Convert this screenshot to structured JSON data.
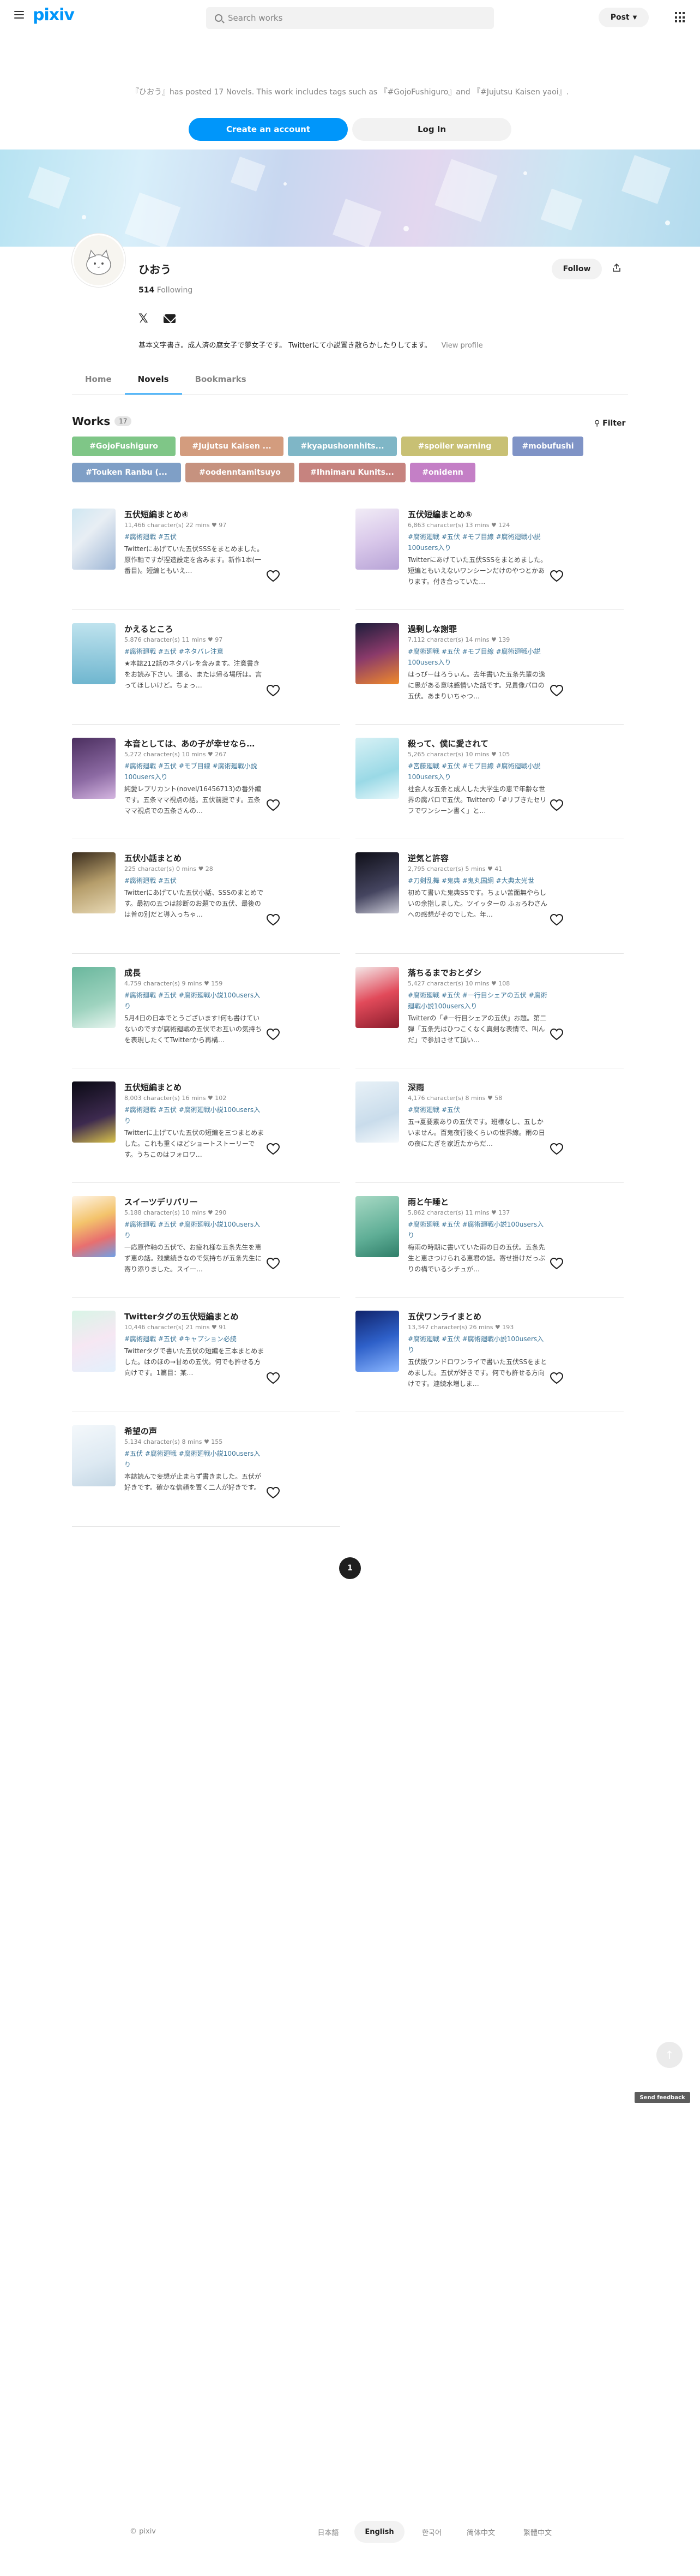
{
  "header": {
    "logo": "pixiv",
    "search_placeholder": "Search works",
    "post_label": "Post"
  },
  "intro": {
    "text": "『ひおう』has posted 17 Novels. This work includes tags such as 『#GojoFushiguro』and 『#Jujutsu Kaisen yaoi』.",
    "create_account": "Create an account",
    "login": "Log In"
  },
  "profile": {
    "name": "ひおう",
    "following_count": "514",
    "following_label": "Following",
    "follow_label": "Follow",
    "bio": "基本文字書き。成人済の腐女子で夢女子です。 Twitterにて小説置き散らかしたりしてます。",
    "view_profile": "View profile"
  },
  "tabs": [
    "Home",
    "Novels",
    "Bookmarks"
  ],
  "works": {
    "title": "Works",
    "count": "17",
    "filter_label": "Filter",
    "tags": [
      {
        "label": "#GojoFushiguro",
        "color": "#7fc687"
      },
      {
        "label": "#Jujutsu Kaisen ...",
        "color": "#d39c7e"
      },
      {
        "label": "#kyapushonnhits...",
        "color": "#7fb6c6"
      },
      {
        "label": "#spoiler warning",
        "color": "#c8c074"
      },
      {
        "label": "#mobufushi",
        "color": "#7f93c6"
      },
      {
        "label": "#Touken Ranbu (...",
        "color": "#7f9fc6"
      },
      {
        "label": "#oodenntamitsuyo",
        "color": "#c6927f"
      },
      {
        "label": "#Ihnimaru Kunits...",
        "color": "#c6837f"
      },
      {
        "label": "#onidenn",
        "color": "#c47fc6"
      }
    ],
    "cards": [
      {
        "title": "五伏短編まとめ④",
        "meta": "11,466 character(s)  22 mins  ♥ 97",
        "tags": "#腐術廻戦 #五伏",
        "desc": "Twitterにあげていた五伏SSSをまとめました。原作軸ですが捏造設定を含みます。新作1本(一番目)。短編ともいえ…"
      },
      {
        "title": "五伏短編まとめ⑤",
        "meta": "6,863 character(s)  13 mins  ♥ 124",
        "tags": "#腐術廻戦 #五伏 #モブ目線 #腐術廻戦小説100users入り",
        "desc": "Twitterにあげていた五伏SSSをまとめました。短編ともいえないワンシーンだけのやつとかあります。付き合っていた…"
      },
      {
        "title": "かえるところ",
        "meta": "5,876 character(s)  11 mins  ♥ 97",
        "tags": "#腐術廻戦 #五伏 #ネタバレ注意",
        "desc": "★本誌212話のネタバレを含みます。注意書きをお読み下さい。還る、または帰る場所は。言ってほしいけど。ちょっ…"
      },
      {
        "title": "過剰しな謝罪",
        "meta": "7,112 character(s)  14 mins  ♥ 139",
        "tags": "#腐術廻戦 #五伏 #モブ目線 #腐術廻戦小説100users入り",
        "desc": "はっぴーはろうぃん。去年書いた五条先輩の逸に愚がある意味感情いた話です。兄貴像パロの五伏。あまりいちゃつ…"
      },
      {
        "title": "本音としては、あの子が幸せなら…",
        "meta": "5,272 character(s)  10 mins  ♥ 267",
        "tags": "#腐術廻戦 #五伏 #モブ目線 #腐術廻戦小説100users入り",
        "desc": "純愛レプリカント(novel/16456713)の番外編です。五条ママ視点の話。五伏前提です。五条ママ視点での五条さんの…"
      },
      {
        "title": "殺って、僕に愛されて",
        "meta": "5,265 character(s)  10 mins  ♥ 105",
        "tags": "#宮藤廻戦 #五伏 #モブ目線 #腐術廻戦小説100users入り",
        "desc": "社会人な五条と成人した大学生の恵で年齢な世界の腐パロで五伏。Twitterの「#リプきたセリフでワンシーン書く」と…"
      },
      {
        "title": "五伏小話まとめ",
        "meta": "225 character(s)  0 mins  ♥ 28",
        "tags": "#腐術廻戦 #五伏",
        "desc": "Twitterにあげていた五伏小話、SSSのまとめです。最初の五つは診断のお題での五伏、最後のは普の別だと導入っちゃ…"
      },
      {
        "title": "逆気と許容",
        "meta": "2,795 character(s)  5 mins  ♥ 41",
        "tags": "#刀剣乱舞 #鬼典 #鬼丸国綱 #大典太光世",
        "desc": "初めて書いた鬼典SSです。ちょい苦面無やらしいの余指しました。ツイッターの ふぉろわさんへの感想がそのでした。年…"
      },
      {
        "title": "成長",
        "meta": "4,759 character(s)  9 mins  ♥ 159",
        "tags": "#腐術廻戦 #五伏 #腐術廻戦小説100users入り",
        "desc": "5月4日の日本でとうございます!何も書けていないのですが腐術廻戦の五伏でお互いの気持ちを表現したくてTwitterから再構…"
      },
      {
        "title": "落ちるまでおとダシ",
        "meta": "5,427 character(s)  10 mins  ♥ 108",
        "tags": "#腐術廻戦 #五伏 #一行目シェアの五伏 #腐術廻戦小説100users入り",
        "desc": "Twitterの「#一行目シェアの五伏」お題。第二弾「五条先はひつこくなく真剣な表情で、叫んだ」で参加させて頂い…"
      },
      {
        "title": "五伏短編まとめ",
        "meta": "8,003 character(s)  16 mins  ♥ 102",
        "tags": "#腐術廻戦 #五伏 #腐術廻戦小説100users入り",
        "desc": "Twitterに上げていた五伏の短編を三つまとめました。これも重くほどショートストーリーです。うちこのはフォロワ…"
      },
      {
        "title": "深雨",
        "meta": "4,176 character(s)  8 mins  ♥ 58",
        "tags": "#腐術廻戦 #五伏",
        "desc": "五→夏要素ありの五伏です。班様なし、五しかいません。百鬼夜行後くらいの世界線。雨の日の夜にたぎを家近たからだ…"
      },
      {
        "title": "スイーツデリバリー",
        "meta": "5,188 character(s)  10 mins  ♥ 290",
        "tags": "#腐術廻戦 #五伏 #腐術廻戦小説100users入り",
        "desc": "一応原作軸の五伏で、お疲れ様な五条先生を恵ず恵の話。残業続きなので気持ちが五条先生に寄り添りました。スイー…"
      },
      {
        "title": "雨と午睡と",
        "meta": "5,862 character(s)  11 mins  ♥ 137",
        "tags": "#腐術廻戦 #五伏 #腐術廻戦小説100users入り",
        "desc": "梅雨の時期に書いていた雨の日の五伏。五条先生と恵さつけられる恵君の話。寄せ掛けだっぷりの構でいるシチュが…"
      },
      {
        "title": "Twitterタグの五伏短編まとめ",
        "meta": "10,446 character(s)  21 mins  ♥ 91",
        "tags": "#腐術廻戦 #五伏 #キャプション必読",
        "desc": "Twitterタグで書いた五伏の短編を三本まとめました。はのほの→甘めの五伏。何でも許せる方向けです。1篇目：某…"
      },
      {
        "title": "五伏ワンライまとめ",
        "meta": "13,347 character(s)  26 mins  ♥ 193",
        "tags": "#腐術廻戦 #五伏 #腐術廻戦小説100users入り",
        "desc": "五伏版ワンドロワンライで書いた五伏SSをまとめました。五伏が好きです。何でも許せる方向けです。連続水増しま…"
      },
      {
        "title": "希望の声",
        "meta": "5,134 character(s)  8 mins  ♥ 155",
        "tags": "#五伏 #腐術廻戦 #腐術廻戦小説100users入り",
        "desc": "本誌読んで妄想が止まらず書きました。五伏が好きです。確かな信頼を置く二人が好きです。"
      }
    ]
  },
  "pagination": {
    "current": "1"
  },
  "feedback_label": "Send feedback",
  "footer": {
    "copyright": "© pixiv",
    "languages": [
      "日本語",
      "English",
      "한국어",
      "简体中文",
      "繁體中文"
    ],
    "active_language": "English"
  }
}
